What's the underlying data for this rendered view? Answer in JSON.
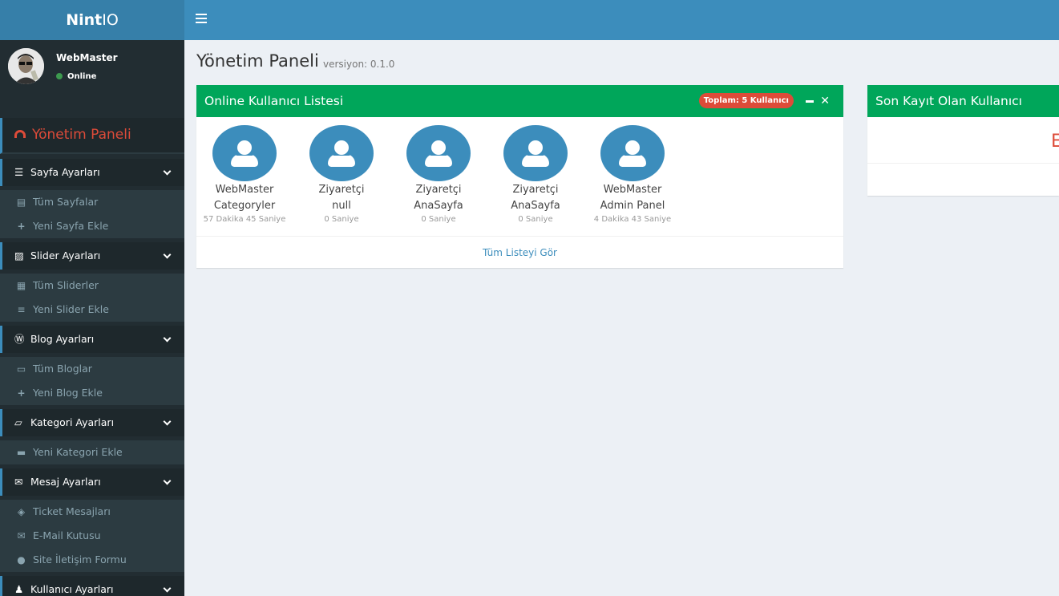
{
  "brand": {
    "prefix": "Nint",
    "suffix": "IO"
  },
  "user": {
    "name": "WebMaster",
    "status": "Online"
  },
  "menu": {
    "header": "Yönetim Paneli",
    "sections": [
      {
        "label": "Sayfa Ayarları",
        "icon": "list-icon",
        "items": [
          {
            "label": "Tüm Sayfalar",
            "icon": "list-alt-icon"
          },
          {
            "label": "Yeni Sayfa Ekle",
            "icon": "plus-icon"
          }
        ]
      },
      {
        "label": "Slider Ayarları",
        "icon": "image-icon",
        "items": [
          {
            "label": "Tüm Sliderler",
            "icon": "grid-icon"
          },
          {
            "label": "Yeni Slider Ekle",
            "icon": "sliders-icon"
          }
        ]
      },
      {
        "label": "Blog Ayarları",
        "icon": "wordpress-icon",
        "items": [
          {
            "label": "Tüm Bloglar",
            "icon": "calendar-icon"
          },
          {
            "label": "Yeni Blog Ekle",
            "icon": "plus-icon"
          }
        ]
      },
      {
        "label": "Kategori Ayarları",
        "icon": "folder-open-icon",
        "items": [
          {
            "label": "Yeni Kategori Ekle",
            "icon": "folder-icon"
          }
        ]
      },
      {
        "label": "Mesaj Ayarları",
        "icon": "envelope-icon",
        "items": [
          {
            "label": "Ticket Mesajları",
            "icon": "ticket-icon"
          },
          {
            "label": "E-Mail Kutusu",
            "icon": "envelope-fill-icon"
          },
          {
            "label": "Site İletişim Formu",
            "icon": "chat-icon"
          }
        ]
      },
      {
        "label": "Kullanıcı Ayarları",
        "icon": "users-icon",
        "items": []
      }
    ]
  },
  "page": {
    "title": "Yönetim Paneli",
    "subtitle": "versiyon: 0.1.0"
  },
  "online_box": {
    "title": "Online Kullanıcı Listesi",
    "badge": "Toplam: 5 Kullanıcı",
    "users": [
      {
        "name": "WebMaster",
        "page": "Categoryler",
        "time": "57 Dakika 45 Saniye"
      },
      {
        "name": "Ziyaretçi",
        "page": "null",
        "time": "0 Saniye"
      },
      {
        "name": "Ziyaretçi",
        "page": "AnaSayfa",
        "time": "0 Saniye"
      },
      {
        "name": "Ziyaretçi",
        "page": "AnaSayfa",
        "time": "0 Saniye"
      },
      {
        "name": "WebMaster",
        "page": "Admin Panel",
        "time": "4 Dakika 43 Saniye"
      }
    ],
    "footer_link": "Tüm Listeyi Gör"
  },
  "recent_box": {
    "title": "Son Kayıt Olan Kullanıcı",
    "partial_text": "E"
  },
  "colors": {
    "header": "#3c8dbc",
    "sidebar": "#222d32",
    "green": "#00a65a",
    "red": "#dd4b39"
  }
}
